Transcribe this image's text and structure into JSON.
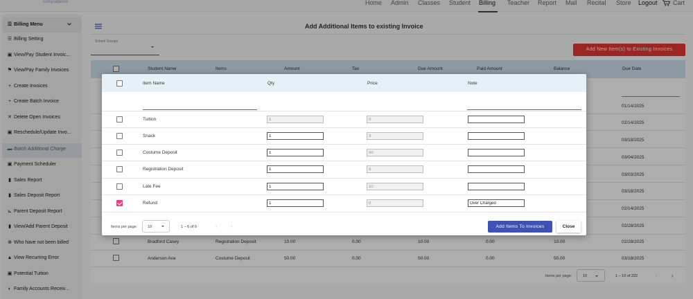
{
  "brand": {
    "logo_text": "compudance"
  },
  "nav": {
    "items": [
      "Home",
      "Admin",
      "Classes",
      "Student",
      "Billing",
      "Teacher",
      "Report",
      "Mail",
      "Recital",
      "Store"
    ],
    "active": "Billing",
    "logout": "Logout",
    "cart": "Cart"
  },
  "sidebar": {
    "header": "Billing Menu",
    "items": [
      {
        "icon": "☰",
        "label": "Billing Setting"
      },
      {
        "icon": "▣",
        "label": "View/Pay Student Invoic..."
      },
      {
        "icon": "⚑",
        "label": "View/Pay Family Invoices"
      },
      {
        "icon": "+",
        "label": "Create Invoices"
      },
      {
        "icon": "+",
        "label": "Create Batch Invoice"
      },
      {
        "icon": "✕",
        "label": "Delete Open Invoices"
      },
      {
        "icon": "▣",
        "label": "Reschedule/Update Invo..."
      },
      {
        "icon": "▬",
        "label": "Batch Additional Charge"
      },
      {
        "icon": "▣",
        "label": "Payment Scheduler"
      },
      {
        "icon": "▮",
        "label": "Sales Report"
      },
      {
        "icon": "▮",
        "label": "Sales Deposit Report"
      },
      {
        "icon": "⊾",
        "label": "Parent Deposit Report"
      },
      {
        "icon": "▮",
        "label": "View/Add Parent Deposit"
      },
      {
        "icon": "⊕",
        "label": "Who have not been billed"
      },
      {
        "icon": "▲",
        "label": "View Recurring Error"
      },
      {
        "icon": "▣",
        "label": "Potential Tuition"
      },
      {
        "icon": "◐",
        "label": "Family Accounts Receiv..."
      }
    ]
  },
  "page": {
    "title": "Add Additional Items to existing Invoice",
    "school_groups_label": "School Groups",
    "add_new_button": "Add New Item(s) to Existing Invoices"
  },
  "bg_table": {
    "columns": [
      "Student Name",
      "Items",
      "Amount",
      "Tax",
      "Due Amount",
      "Paid Amount",
      "Balance",
      "Due Date"
    ],
    "visible_dates": [
      "01/14/2025",
      "02/14/2025",
      "03/18/2025",
      "03/04/2025",
      "03/03/2025",
      "03/18/2025",
      "02/14/2025",
      "02/28/2025"
    ],
    "rows": [
      {
        "name": "Bradford Casey",
        "item": "Registration Deposit",
        "amount": "10.00",
        "tax": "0.00",
        "due": "10.00",
        "paid": "0.00",
        "balance": "10.00",
        "date": "02/28/2025"
      },
      {
        "name": "Anderson Ava",
        "item": "Costume Deposit",
        "amount": "50.00",
        "tax": "0.00",
        "due": "50.00",
        "paid": "0.00",
        "balance": "50.00",
        "date": "03/18/2025"
      }
    ],
    "items_per_page_label": "Items per page:",
    "items_per_page": "10",
    "range": "1 – 10 of 222"
  },
  "modal": {
    "columns": {
      "name": "Item Name",
      "qty": "Qty",
      "price": "Price",
      "note": "Note"
    },
    "rows": [
      {
        "name": "Tuition",
        "qty": "1",
        "qty_readonly": true,
        "price": "0",
        "note": "",
        "checked": false
      },
      {
        "name": "Snack",
        "qty": "1",
        "qty_readonly": false,
        "price": "3",
        "note": "",
        "checked": false
      },
      {
        "name": "Costume Deposit",
        "qty": "1",
        "qty_readonly": false,
        "price": "50",
        "note": "",
        "checked": false
      },
      {
        "name": "Registration Deposit",
        "qty": "1",
        "qty_readonly": false,
        "price": "5",
        "note": "",
        "checked": false
      },
      {
        "name": "Late Fee",
        "qty": "1",
        "qty_readonly": false,
        "price": "10",
        "note": "",
        "checked": false
      },
      {
        "name": "Refund",
        "qty": "1",
        "qty_readonly": false,
        "price": "0",
        "note": "Over Charged",
        "checked": true
      }
    ],
    "items_per_page_label": "Items per page:",
    "items_per_page": "10",
    "range": "1 – 6 of 6",
    "add_button": "Add Items To Invoices",
    "close_button": "Close"
  },
  "colors": {
    "primary": "#3f51b5",
    "danger": "#e53935",
    "checkbox_checked": "#ec407a",
    "table_header": "#cfe3f0"
  }
}
